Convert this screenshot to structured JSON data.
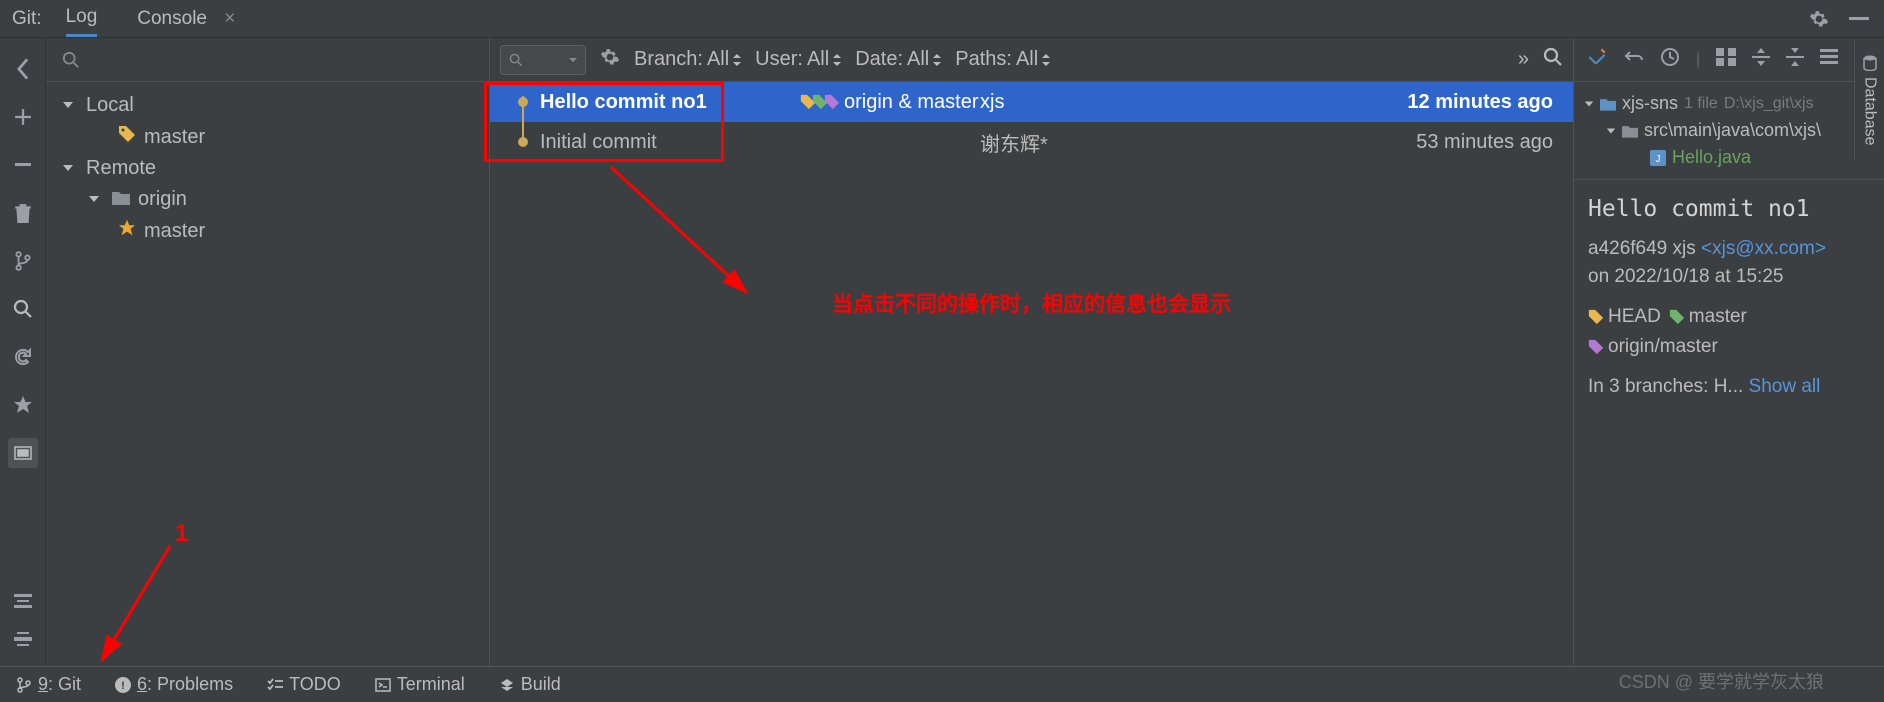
{
  "topTabs": {
    "label": "Git:",
    "tabs": [
      "Log",
      "Console"
    ],
    "activeTab": 0
  },
  "branches": {
    "local": {
      "label": "Local",
      "items": [
        {
          "name": "master",
          "icon": "tag"
        }
      ]
    },
    "remote": {
      "label": "Remote",
      "items": [
        {
          "name": "origin",
          "children": [
            {
              "name": "master",
              "icon": "star"
            }
          ]
        }
      ]
    }
  },
  "logFilters": {
    "branch": {
      "label": "Branch:",
      "value": "All"
    },
    "user": {
      "label": "User:",
      "value": "All"
    },
    "date": {
      "label": "Date:",
      "value": "All"
    },
    "paths": {
      "label": "Paths:",
      "value": "All"
    }
  },
  "commits": [
    {
      "message": "Hello commit no1",
      "refs": "origin & master",
      "author": "xjs",
      "date": "12 minutes ago",
      "selected": true
    },
    {
      "message": "Initial commit",
      "refs": "",
      "author": "谢东辉*",
      "date": "53 minutes ago",
      "selected": false
    }
  ],
  "annotation": "当点击不同的操作时，相应的信息也会显示",
  "redNumber": "1",
  "fileTree": {
    "project": "xjs-sns",
    "fileCount": "1 file",
    "path": "D:\\xjs_git\\xjs",
    "srcPath": "src\\main\\java\\com\\xjs\\",
    "file": "Hello.java"
  },
  "commitDetails": {
    "title": "Hello commit no1",
    "hash": "a426f649",
    "authorName": "xjs",
    "email": "<xjs@xx.com>",
    "dateText": "on 2022/10/18 at 15:25",
    "refs": [
      {
        "label": "HEAD",
        "color": "#e6b84e"
      },
      {
        "label": "master",
        "color": "#6fb36f"
      },
      {
        "label": "origin/master",
        "color": "#b678d6"
      }
    ],
    "branchesText": "In 3 branches: H...",
    "showAll": "Show all"
  },
  "statusBar": {
    "git": "9: Git",
    "problems": "6: Problems",
    "todo": "TODO",
    "terminal": "Terminal",
    "build": "Build"
  },
  "watermark": "CSDN @ 要学就学灰太狼",
  "rightTab": "Database"
}
